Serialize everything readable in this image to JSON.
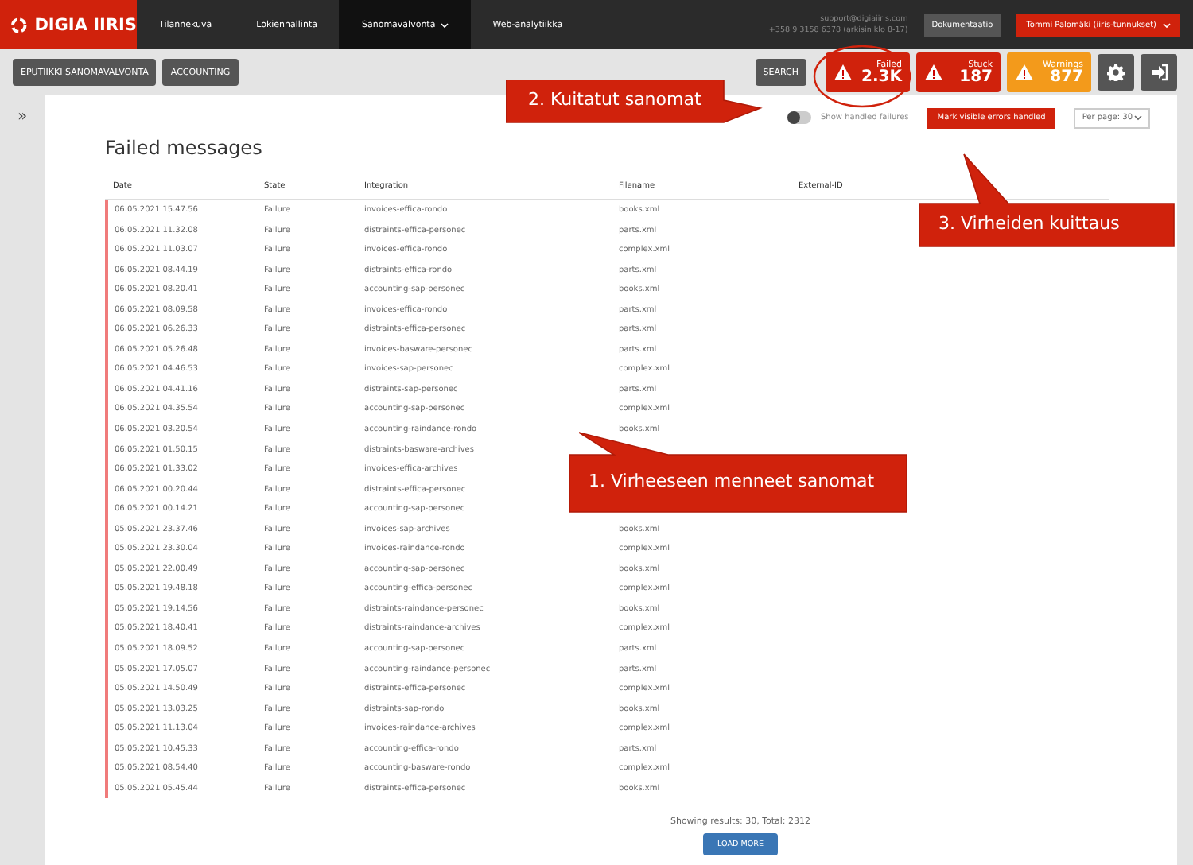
{
  "topbar": {
    "logo": "DIGIA IIRIS",
    "nav": [
      {
        "label": "Tilannekuva",
        "selected": false,
        "dropdown": false
      },
      {
        "label": "Lokienhallinta",
        "selected": false,
        "dropdown": false
      },
      {
        "label": "Sanomavalvonta",
        "selected": true,
        "dropdown": true
      },
      {
        "label": "Web-analytiikka",
        "selected": false,
        "dropdown": false
      }
    ],
    "support_email": "support@digiaiiris.com",
    "support_phone": "+358 9 3158 6378 (arkisin klo 8-17)",
    "docs": "Dokumentaatio",
    "user": "Tommi Palomäki (iiris-tunnukset)"
  },
  "toolbar": {
    "filters": [
      "EPUTIIKKI SANOMAVALVONTA",
      "ACCOUNTING"
    ],
    "search": "SEARCH",
    "counters": [
      {
        "label": "Failed",
        "value": "2.3K",
        "color": "#d0220c"
      },
      {
        "label": "Stuck",
        "value": "187",
        "color": "#d0220c"
      },
      {
        "label": "Warnings",
        "value": "877",
        "color": "#f39a1b"
      }
    ]
  },
  "sidebar": {
    "toggle": "»"
  },
  "page": {
    "title": "Failed messages",
    "show_handled": {
      "label": "Show handled failures",
      "on": false
    },
    "mark_button": "Mark visible errors handled",
    "per_page": "Per page: 30"
  },
  "table": {
    "columns": [
      "Date",
      "State",
      "Integration",
      "Filename",
      "External-ID"
    ],
    "rows": [
      {
        "date": "06.05.2021 15.47.56",
        "state": "Failure",
        "integration": "invoices-effica-rondo",
        "filename": "books.xml"
      },
      {
        "date": "06.05.2021 11.32.08",
        "state": "Failure",
        "integration": "distraints-effica-personec",
        "filename": "parts.xml"
      },
      {
        "date": "06.05.2021 11.03.07",
        "state": "Failure",
        "integration": "invoices-effica-rondo",
        "filename": "complex.xml"
      },
      {
        "date": "06.05.2021 08.44.19",
        "state": "Failure",
        "integration": "distraints-effica-rondo",
        "filename": "parts.xml"
      },
      {
        "date": "06.05.2021 08.20.41",
        "state": "Failure",
        "integration": "accounting-sap-personec",
        "filename": "books.xml"
      },
      {
        "date": "06.05.2021 08.09.58",
        "state": "Failure",
        "integration": "invoices-effica-rondo",
        "filename": "parts.xml"
      },
      {
        "date": "06.05.2021 06.26.33",
        "state": "Failure",
        "integration": "distraints-effica-personec",
        "filename": "parts.xml"
      },
      {
        "date": "06.05.2021 05.26.48",
        "state": "Failure",
        "integration": "invoices-basware-personec",
        "filename": "parts.xml"
      },
      {
        "date": "06.05.2021 04.46.53",
        "state": "Failure",
        "integration": "invoices-sap-personec",
        "filename": "complex.xml"
      },
      {
        "date": "06.05.2021 04.41.16",
        "state": "Failure",
        "integration": "distraints-sap-personec",
        "filename": "parts.xml"
      },
      {
        "date": "06.05.2021 04.35.54",
        "state": "Failure",
        "integration": "accounting-sap-personec",
        "filename": "complex.xml"
      },
      {
        "date": "06.05.2021 03.20.54",
        "state": "Failure",
        "integration": "accounting-raindance-rondo",
        "filename": "books.xml"
      },
      {
        "date": "06.05.2021 01.50.15",
        "state": "Failure",
        "integration": "distraints-basware-archives"
      },
      {
        "date": "06.05.2021 01.33.02",
        "state": "Failure",
        "integration": "invoices-effica-archives"
      },
      {
        "date": "06.05.2021 00.20.44",
        "state": "Failure",
        "integration": "distraints-effica-personec"
      },
      {
        "date": "06.05.2021 00.14.21",
        "state": "Failure",
        "integration": "accounting-sap-personec"
      },
      {
        "date": "05.05.2021 23.37.46",
        "state": "Failure",
        "integration": "invoices-sap-archives",
        "filename": "books.xml"
      },
      {
        "date": "05.05.2021 23.30.04",
        "state": "Failure",
        "integration": "invoices-raindance-rondo",
        "filename": "complex.xml"
      },
      {
        "date": "05.05.2021 22.00.49",
        "state": "Failure",
        "integration": "accounting-sap-personec",
        "filename": "books.xml"
      },
      {
        "date": "05.05.2021 19.48.18",
        "state": "Failure",
        "integration": "accounting-effica-personec",
        "filename": "complex.xml"
      },
      {
        "date": "05.05.2021 19.14.56",
        "state": "Failure",
        "integration": "distraints-raindance-personec",
        "filename": "books.xml"
      },
      {
        "date": "05.05.2021 18.40.41",
        "state": "Failure",
        "integration": "distraints-raindance-archives",
        "filename": "complex.xml"
      },
      {
        "date": "05.05.2021 18.09.52",
        "state": "Failure",
        "integration": "accounting-sap-personec",
        "filename": "parts.xml"
      },
      {
        "date": "05.05.2021 17.05.07",
        "state": "Failure",
        "integration": "accounting-raindance-personec",
        "filename": "parts.xml"
      },
      {
        "date": "05.05.2021 14.50.49",
        "state": "Failure",
        "integration": "distraints-effica-personec",
        "filename": "complex.xml"
      },
      {
        "date": "05.05.2021 13.03.25",
        "state": "Failure",
        "integration": "distraints-sap-rondo",
        "filename": "books.xml"
      },
      {
        "date": "05.05.2021 11.13.04",
        "state": "Failure",
        "integration": "invoices-raindance-archives",
        "filename": "complex.xml"
      },
      {
        "date": "05.05.2021 10.45.33",
        "state": "Failure",
        "integration": "accounting-effica-rondo",
        "filename": "parts.xml"
      },
      {
        "date": "05.05.2021 08.54.40",
        "state": "Failure",
        "integration": "accounting-basware-rondo",
        "filename": "complex.xml"
      },
      {
        "date": "05.05.2021 05.45.44",
        "state": "Failure",
        "integration": "distraints-effica-personec",
        "filename": "books.xml"
      }
    ]
  },
  "results": "Showing results: 30, Total: 2312",
  "load_more": "LOAD MORE",
  "annotations": [
    {
      "text": "2. Kuitatut sanomat",
      "kind": "right"
    },
    {
      "text": "3. Virheiden kuittaus",
      "kind": "up"
    },
    {
      "text": "1. Virheeseen menneet sanomat",
      "kind": "upleft"
    }
  ]
}
